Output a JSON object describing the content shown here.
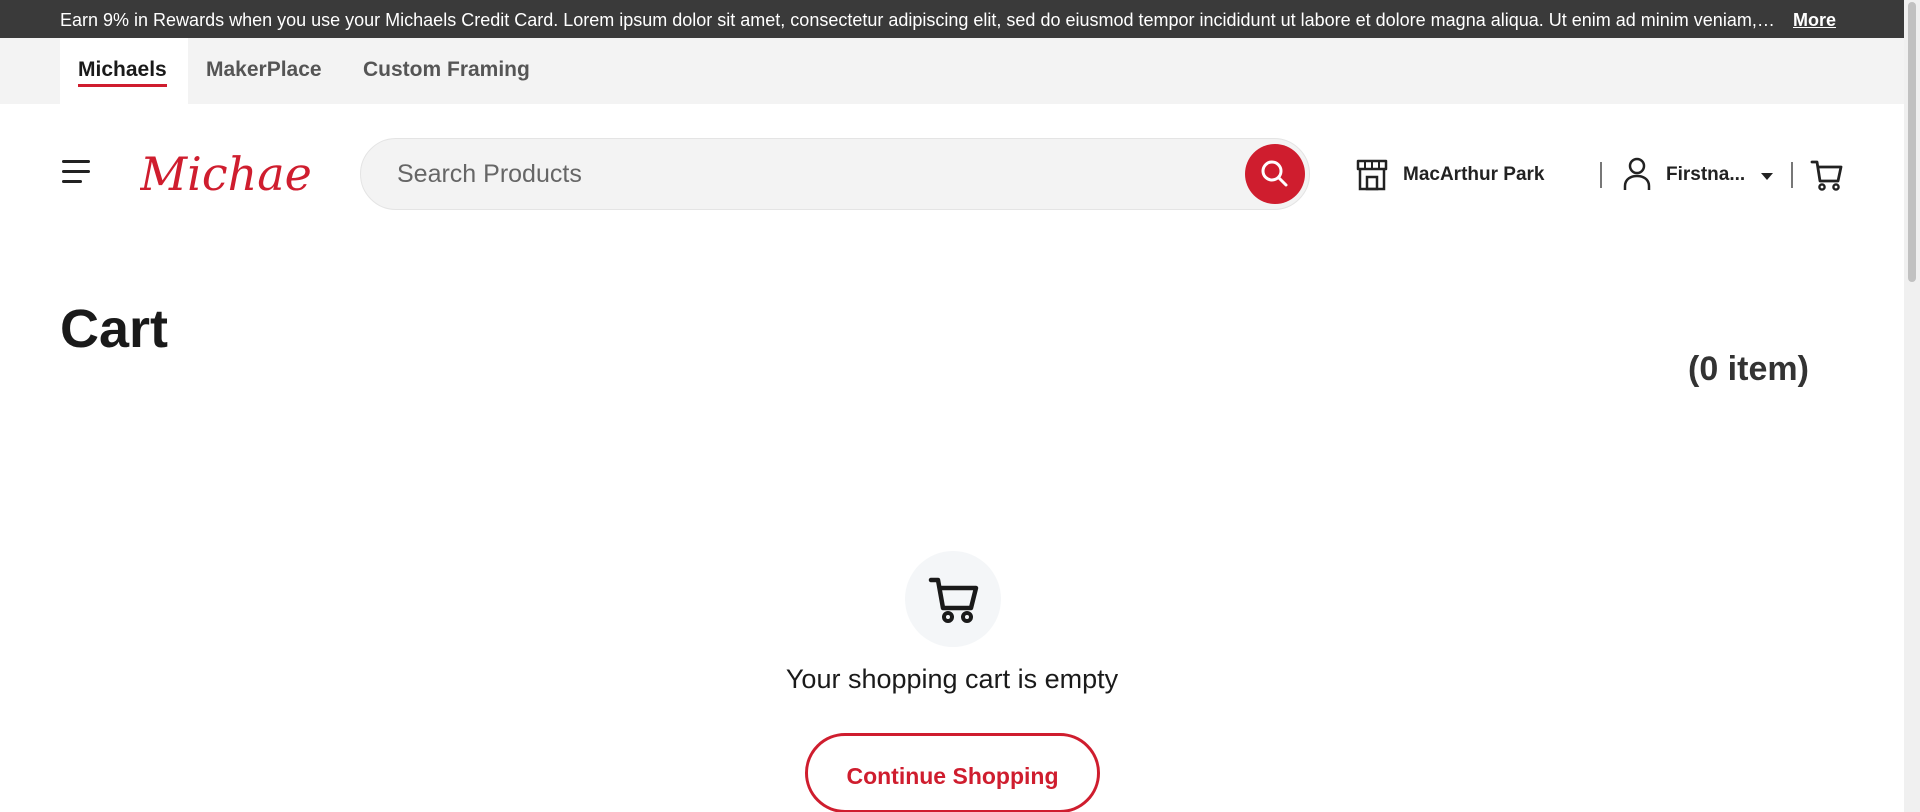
{
  "promo": {
    "text": "Earn 9% in Rewards when you use your Michaels Credit Card. Lorem ipsum dolor sit amet, consectetur adipiscing elit, sed do eiusmod tempor incididunt ut labore et dolore magna aliqua. Ut enim ad minim veniam, quis nostrud exercitation",
    "more_label": "More"
  },
  "brand_tabs": [
    {
      "label": "Michaels",
      "active": true
    },
    {
      "label": "MakerPlace",
      "active": false
    },
    {
      "label": "Custom Framing",
      "active": false
    }
  ],
  "header": {
    "logo_text": "Michaels",
    "search_placeholder": "Search Products",
    "store_name": "MacArthur Park",
    "account_name": "Firstna...",
    "icons": [
      "menu-icon",
      "search-icon",
      "store-icon",
      "user-icon",
      "caret-down-icon",
      "cart-icon"
    ]
  },
  "main": {
    "title": "Cart",
    "item_count": "(0 item)",
    "empty_message": "Your shopping cart is empty",
    "continue_label": "Continue Shopping"
  },
  "colors": {
    "brand_red": "#cf1d2e",
    "promo_bg": "#3a3a3a",
    "brandbar_bg": "#f3f3f3"
  }
}
